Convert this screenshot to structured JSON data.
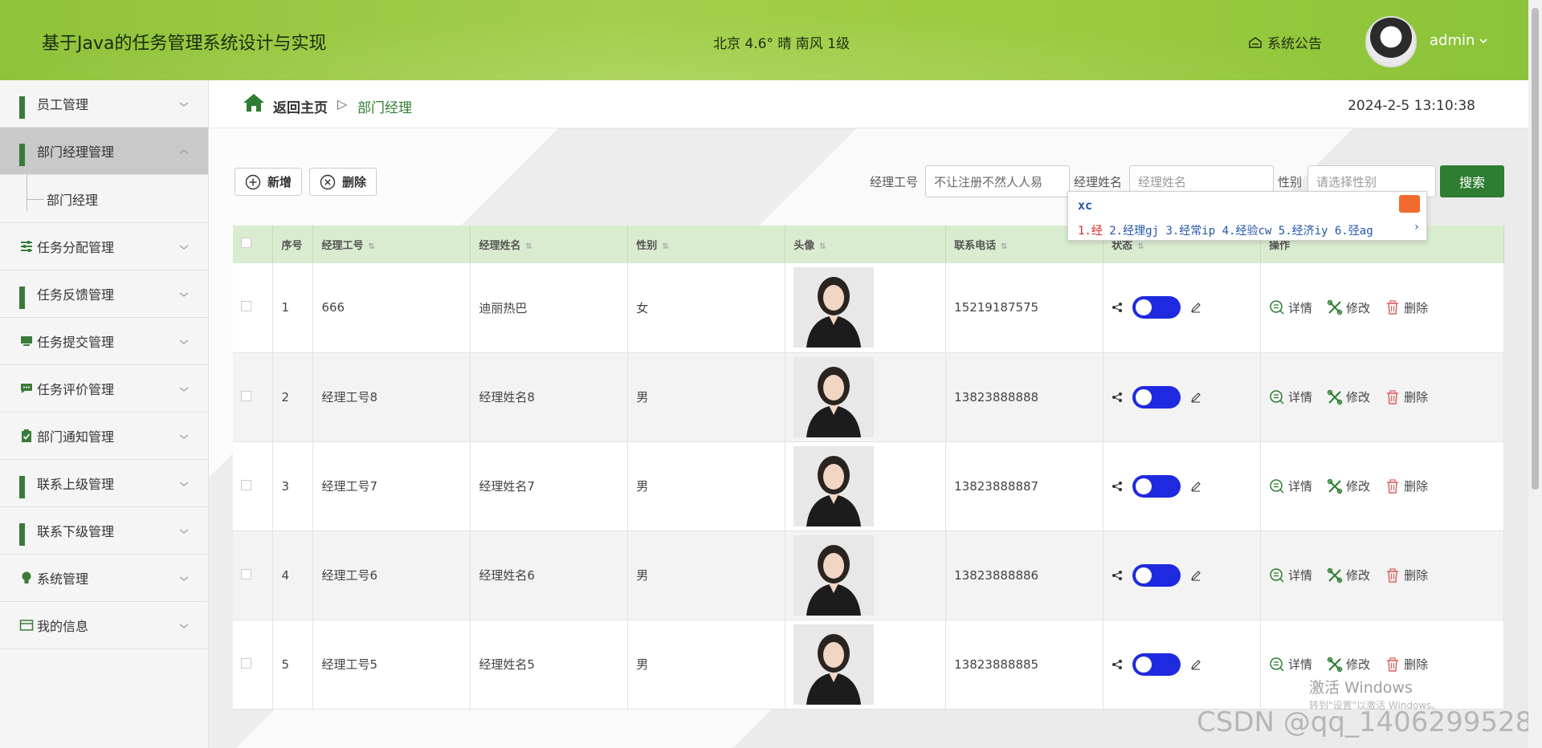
{
  "header": {
    "title": "基于Java的任务管理系统设计与实现",
    "weather": "北京 4.6° 晴 南风 1级",
    "notice": "系统公告",
    "user": "admin"
  },
  "sidebar": {
    "items": [
      {
        "label": "员工管理"
      },
      {
        "label": "部门经理管理",
        "active": true
      },
      {
        "label": "任务分配管理"
      },
      {
        "label": "任务反馈管理"
      },
      {
        "label": "任务提交管理"
      },
      {
        "label": "任务评价管理"
      },
      {
        "label": "部门通知管理"
      },
      {
        "label": "联系上级管理"
      },
      {
        "label": "联系下级管理"
      },
      {
        "label": "系统管理"
      },
      {
        "label": "我的信息"
      }
    ],
    "sub_item": "部门经理"
  },
  "breadcrumb": {
    "home": "返回主页",
    "sep": "▷",
    "current": "部门经理"
  },
  "datetime": "2024-2-5 13:10:38",
  "toolbar": {
    "add": "新增",
    "delete": "删除"
  },
  "search": {
    "id_label": "经理工号",
    "id_value": "不让注册不然人人易",
    "name_label": "经理姓名",
    "name_placeholder": "经理姓名",
    "gender_label": "性别",
    "gender_placeholder": "请选择性别",
    "button": "搜索"
  },
  "ime": {
    "input": "xc",
    "candidates": [
      "1.经",
      "2.经理gj",
      "3.经常ip",
      "4.经验cw",
      "5.经济iy",
      "6.弪ag"
    ]
  },
  "table": {
    "columns": [
      "序号",
      "经理工号",
      "经理姓名",
      "性别",
      "头像",
      "联系电话",
      "状态",
      "操作"
    ],
    "rows": [
      {
        "no": "1",
        "id": "666",
        "name": "迪丽热巴",
        "gender": "女",
        "phone": "15219187575"
      },
      {
        "no": "2",
        "id": "经理工号8",
        "name": "经理姓名8",
        "gender": "男",
        "phone": "13823888888"
      },
      {
        "no": "3",
        "id": "经理工号7",
        "name": "经理姓名7",
        "gender": "男",
        "phone": "13823888887"
      },
      {
        "no": "4",
        "id": "经理工号6",
        "name": "经理姓名6",
        "gender": "男",
        "phone": "13823888886"
      },
      {
        "no": "5",
        "id": "经理工号5",
        "name": "经理姓名5",
        "gender": "男",
        "phone": "13823888885"
      }
    ],
    "ops": {
      "detail": "详情",
      "edit": "修改",
      "delete": "删除"
    }
  },
  "watermark": {
    "line1": "激活 Windows",
    "line2": "转到\"设置\"以激活 Windows。",
    "csdn": "CSDN @qq_1406299528"
  },
  "colors": {
    "primary": "#2e7d32",
    "header": "#9acb3f",
    "toggle": "#1f2ae0"
  }
}
